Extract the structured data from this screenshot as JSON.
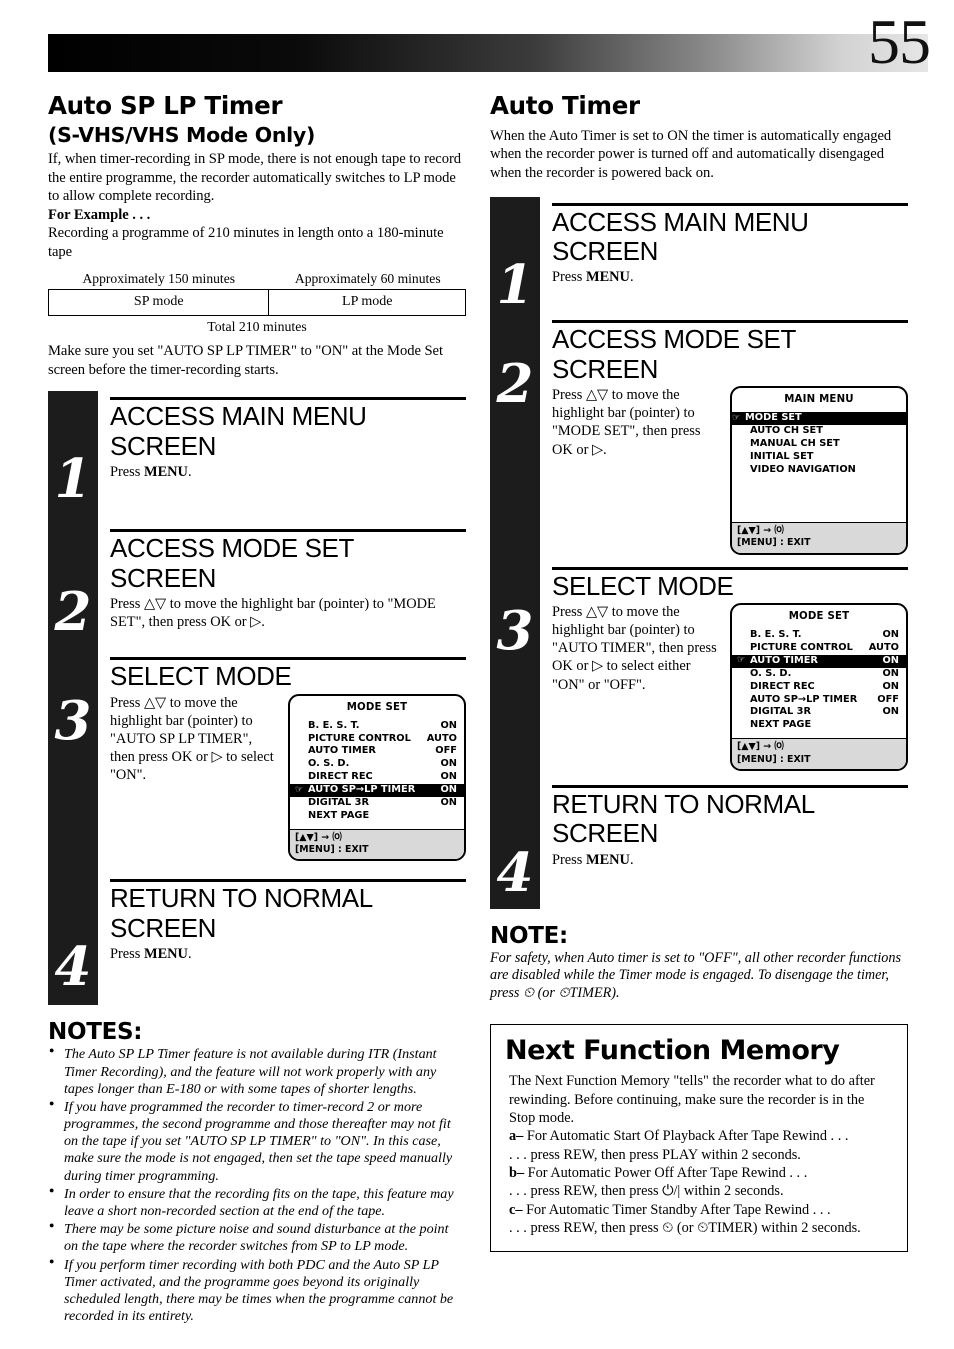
{
  "page": {
    "number": "55"
  },
  "left": {
    "title": "Auto SP   LP Timer",
    "subtitle": "(S-VHS/VHS Mode Only)",
    "intro": "If, when timer-recording in SP mode, there is not enough tape to record the entire programme, the recorder automatically switches to LP mode to allow complete recording.",
    "example_label": "For Example . . .",
    "example_text": "Recording a programme of 210 minutes in length onto a 180-minute tape",
    "table": {
      "caption_left": "Approximately 150 minutes",
      "caption_right": "Approximately 60 minutes",
      "cell_left": "SP mode",
      "cell_right": "LP mode",
      "total": "Total 210 minutes"
    },
    "after_table": "Make sure you set \"AUTO SP   LP TIMER\" to \"ON\" at the Mode Set screen before the timer-recording starts.",
    "steps": [
      {
        "num": "1",
        "head": "ACCESS MAIN MENU SCREEN",
        "body_pre": "Press ",
        "body_bold": "MENU",
        "body_post": "."
      },
      {
        "num": "2",
        "head": "ACCESS MODE SET SCREEN",
        "body": "Press △▽ to move the highlight bar (pointer) to \"MODE SET\", then press OK or ▷."
      },
      {
        "num": "3",
        "head": "SELECT MODE",
        "body": "Press △▽ to move the highlight bar (pointer) to \"AUTO SP   LP TIMER\", then press OK or ▷ to select \"ON\"."
      },
      {
        "num": "4",
        "head": "RETURN TO NORMAL SCREEN",
        "body_pre": "Press ",
        "body_bold": "MENU",
        "body_post": "."
      }
    ],
    "mode_set_screen": {
      "title": "MODE SET",
      "rows": [
        {
          "pointer": false,
          "label": "B. E. S. T.",
          "value": "ON",
          "highlight": false
        },
        {
          "pointer": false,
          "label": "PICTURE CONTROL",
          "value": "AUTO",
          "highlight": false
        },
        {
          "pointer": false,
          "label": "AUTO TIMER",
          "value": "OFF",
          "highlight": false
        },
        {
          "pointer": false,
          "label": "O. S. D.",
          "value": "ON",
          "highlight": false
        },
        {
          "pointer": false,
          "label": "DIRECT REC",
          "value": "ON",
          "highlight": false
        },
        {
          "pointer": true,
          "label": "AUTO SP→LP TIMER",
          "value": "ON",
          "highlight": true
        },
        {
          "pointer": false,
          "label": "DIGITAL 3R",
          "value": "ON",
          "highlight": false
        },
        {
          "pointer": false,
          "label": "NEXT PAGE",
          "value": "",
          "highlight": false
        }
      ],
      "footer_line1": "[▲▼] →  ⒪",
      "footer_line2": "[MENU] : EXIT"
    },
    "notes_title": "NOTES:",
    "notes": [
      "The Auto SP   LP Timer feature is not available during ITR (Instant Timer Recording), and the feature will not work properly with any tapes longer than E-180 or with some tapes of shorter lengths.",
      "If you have programmed the recorder to timer-record 2 or more programmes, the second programme and those thereafter may not fit on the tape if you set \"AUTO SP   LP TIMER\" to \"ON\". In this case, make sure the mode is not engaged, then set the tape speed manually during timer programming.",
      "In order to ensure that the recording fits on the tape, this feature may leave a short non-recorded section at the end of the tape.",
      "There may be some picture noise and sound disturbance at the point on the tape where the recorder switches from SP to LP mode.",
      "If you perform timer recording with both PDC and the Auto SP   LP Timer activated, and the programme goes beyond its originally scheduled length, there may be times when the programme cannot be recorded in its entirety."
    ]
  },
  "right": {
    "title": "Auto Timer",
    "intro": "When the Auto Timer is set to ON the timer is automatically engaged when the recorder power is turned off and automatically disengaged when the recorder is powered back on.",
    "steps": [
      {
        "num": "1",
        "head": "ACCESS MAIN MENU SCREEN",
        "body_pre": "Press ",
        "body_bold": "MENU",
        "body_post": "."
      },
      {
        "num": "2",
        "head": "ACCESS MODE SET SCREEN",
        "body": "Press △▽ to move the highlight bar (pointer) to \"MODE SET\", then press OK or ▷."
      },
      {
        "num": "3",
        "head": "SELECT MODE",
        "body": "Press △▽ to move the highlight bar (pointer) to \"AUTO TIMER\", then press OK or ▷ to select either \"ON\" or \"OFF\"."
      },
      {
        "num": "4",
        "head": "RETURN TO NORMAL SCREEN",
        "body_pre": "Press ",
        "body_bold": "MENU",
        "body_post": "."
      }
    ],
    "main_menu_screen": {
      "title": "MAIN MENU",
      "rows": [
        {
          "pointer": true,
          "label": "MODE SET",
          "value": "",
          "highlight": true
        },
        {
          "pointer": false,
          "label": "AUTO CH SET",
          "value": "",
          "highlight": false
        },
        {
          "pointer": false,
          "label": "MANUAL CH SET",
          "value": "",
          "highlight": false
        },
        {
          "pointer": false,
          "label": "INITIAL SET",
          "value": "",
          "highlight": false
        },
        {
          "pointer": false,
          "label": "VIDEO NAVIGATION",
          "value": "",
          "highlight": false
        }
      ],
      "footer_line1": "[▲▼] →  ⒪",
      "footer_line2": "[MENU] : EXIT"
    },
    "mode_set_screen": {
      "title": "MODE SET",
      "rows": [
        {
          "pointer": false,
          "label": "B. E. S. T.",
          "value": "ON",
          "highlight": false
        },
        {
          "pointer": false,
          "label": "PICTURE CONTROL",
          "value": "AUTO",
          "highlight": false
        },
        {
          "pointer": true,
          "label": "AUTO TIMER",
          "value": "ON",
          "highlight": true
        },
        {
          "pointer": false,
          "label": "O. S. D.",
          "value": "ON",
          "highlight": false
        },
        {
          "pointer": false,
          "label": "DIRECT REC",
          "value": "ON",
          "highlight": false
        },
        {
          "pointer": false,
          "label": "AUTO SP→LP TIMER",
          "value": "OFF",
          "highlight": false
        },
        {
          "pointer": false,
          "label": "DIGITAL 3R",
          "value": "ON",
          "highlight": false
        },
        {
          "pointer": false,
          "label": "NEXT PAGE",
          "value": "",
          "highlight": false
        }
      ],
      "footer_line1": "[▲▼] →  ⒪",
      "footer_line2": "[MENU] : EXIT"
    },
    "note_title": "NOTE:",
    "note_body": "For safety, when Auto timer is set to \"OFF\", all other recorder functions are disabled while the Timer mode is engaged. To disengage the timer, press ⏲ (or ⏲TIMER).",
    "nfm": {
      "title": "Next Function Memory",
      "intro": "The Next Function Memory \"tells\" the recorder what to do after rewinding. Before continuing, make sure the recorder is in the Stop mode.",
      "items": [
        {
          "lead": "a–",
          "line1": " For Automatic Start Of Playback After Tape Rewind . . .",
          "line2": ". . . press REW, then press PLAY within 2 seconds."
        },
        {
          "lead": "b–",
          "line1": " For Automatic Power Off After Tape Rewind . . .",
          "line2": ". . . press REW, then press ⏻/| within 2 seconds."
        },
        {
          "lead": "c–",
          "line1": " For Automatic Timer Standby After Tape Rewind . . .",
          "line2": ". . . press REW, then press ⏲ (or ⏲TIMER) within 2 seconds."
        }
      ]
    }
  }
}
